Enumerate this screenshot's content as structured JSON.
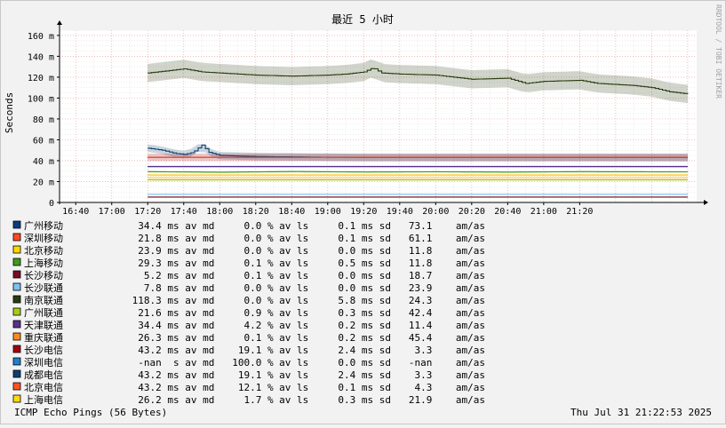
{
  "chart_data": {
    "type": "line",
    "title": "最近 5 小时",
    "ylabel": "Seconds",
    "watermark": "RRDTOOL / TOBI OETIKER",
    "ylim": [
      0,
      165
    ],
    "y_ticks": [
      {
        "value": 0,
        "label": "0"
      },
      {
        "value": 20,
        "label": "20 m"
      },
      {
        "value": 40,
        "label": "40 m"
      },
      {
        "value": 60,
        "label": "60 m"
      },
      {
        "value": 80,
        "label": "80 m"
      },
      {
        "value": 100,
        "label": "100 m"
      },
      {
        "value": 120,
        "label": "120 m"
      },
      {
        "value": 140,
        "label": "140 m"
      },
      {
        "value": 160,
        "label": "160 m"
      }
    ],
    "x_ticks": [
      "16:40",
      "17:00",
      "17:20",
      "17:40",
      "18:00",
      "18:20",
      "18:40",
      "19:00",
      "19:20",
      "19:40",
      "20:00",
      "20:20",
      "20:40",
      "21:00",
      "21:20"
    ],
    "x_range_minutes": [
      -49,
      305
    ],
    "series": [
      {
        "name": "广州移动",
        "color": "#0b3c83",
        "avg": 34.4,
        "loss": 0.0,
        "sd": 0.1,
        "ratio": "73.1",
        "unit": "ms",
        "points": [
          [
            0,
            34.4
          ],
          [
            300,
            34.4
          ]
        ]
      },
      {
        "name": "深圳移动",
        "color": "#ff4a25",
        "avg": 21.8,
        "loss": 0.0,
        "sd": 0.1,
        "ratio": "61.1",
        "unit": "ms",
        "points": [
          [
            0,
            21.8
          ],
          [
            300,
            21.8
          ]
        ]
      },
      {
        "name": "北京移动",
        "color": "#ffd700",
        "avg": 23.9,
        "loss": 0.0,
        "sd": 0.0,
        "ratio": "11.8",
        "unit": "ms",
        "points": [
          [
            0,
            23.9
          ],
          [
            300,
            23.9
          ]
        ]
      },
      {
        "name": "上海移动",
        "color": "#3f9b18",
        "avg": 29.3,
        "loss": 0.1,
        "sd": 0.5,
        "ratio": "11.8",
        "unit": "ms",
        "points": [
          [
            0,
            29.5
          ],
          [
            40,
            29.0
          ],
          [
            80,
            29.6
          ],
          [
            120,
            29.2
          ],
          [
            160,
            29.4
          ],
          [
            200,
            29.1
          ],
          [
            240,
            29.5
          ],
          [
            300,
            29.3
          ]
        ]
      },
      {
        "name": "长沙移动",
        "color": "#7a0b24",
        "avg": 5.2,
        "loss": 0.1,
        "sd": 0.0,
        "ratio": "18.7",
        "unit": "ms",
        "points": [
          [
            0,
            5.2
          ],
          [
            300,
            5.2
          ]
        ]
      },
      {
        "name": "长沙联通",
        "color": "#77c3f4",
        "avg": 7.8,
        "loss": 0.0,
        "sd": 0.0,
        "ratio": "23.9",
        "unit": "ms",
        "points": [
          [
            0,
            7.8
          ],
          [
            300,
            7.8
          ]
        ]
      },
      {
        "name": "南京联通",
        "color": "#283c0f",
        "avg": 118.3,
        "loss": 0.0,
        "sd": 5.8,
        "ratio": "24.3",
        "unit": "ms",
        "points": [
          [
            0,
            124
          ],
          [
            10,
            126
          ],
          [
            20,
            128
          ],
          [
            30,
            125
          ],
          [
            40,
            124
          ],
          [
            60,
            122
          ],
          [
            80,
            121
          ],
          [
            100,
            122
          ],
          [
            110,
            123
          ],
          [
            120,
            125
          ],
          [
            125,
            129
          ],
          [
            130,
            124
          ],
          [
            140,
            123
          ],
          [
            160,
            122
          ],
          [
            180,
            118
          ],
          [
            200,
            119
          ],
          [
            210,
            114
          ],
          [
            220,
            116
          ],
          [
            240,
            117
          ],
          [
            250,
            114
          ],
          [
            260,
            113
          ],
          [
            270,
            112
          ],
          [
            280,
            110
          ],
          [
            290,
            106
          ],
          [
            300,
            104
          ]
        ]
      },
      {
        "name": "广州联通",
        "color": "#a6cb16",
        "avg": 21.6,
        "loss": 0.9,
        "sd": 0.3,
        "ratio": "42.4",
        "unit": "ms",
        "points": [
          [
            0,
            21.6
          ],
          [
            300,
            21.6
          ]
        ]
      },
      {
        "name": "天津联通",
        "color": "#56318c",
        "avg": 34.4,
        "loss": 4.2,
        "sd": 0.2,
        "ratio": "11.4",
        "unit": "ms",
        "points": [
          [
            0,
            34.4
          ],
          [
            300,
            34.4
          ]
        ]
      },
      {
        "name": "重庆联通",
        "color": "#fc8b1e",
        "avg": 26.3,
        "loss": 0.1,
        "sd": 0.2,
        "ratio": "45.4",
        "unit": "ms",
        "points": [
          [
            0,
            26.3
          ],
          [
            300,
            26.3
          ]
        ]
      },
      {
        "name": "长沙电信",
        "color": "#a4000d",
        "avg": 43.2,
        "loss": 19.1,
        "sd": 2.4,
        "ratio": "3.3",
        "unit": "ms",
        "points": [
          [
            0,
            43.2
          ],
          [
            300,
            43.2
          ]
        ]
      },
      {
        "name": "深圳电信",
        "color": "#1f80cb",
        "avg": "-nan",
        "loss": 100.0,
        "sd": 0.0,
        "ratio": "-nan",
        "unit": "s",
        "points": []
      },
      {
        "name": "成都电信",
        "color": "#0e3f6e",
        "avg": 43.2,
        "loss": 19.1,
        "sd": 2.4,
        "ratio": "3.3",
        "unit": "ms",
        "points": [
          [
            0,
            52
          ],
          [
            8,
            50
          ],
          [
            15,
            47
          ],
          [
            20,
            46
          ],
          [
            25,
            48
          ],
          [
            30,
            55
          ],
          [
            34,
            48
          ],
          [
            40,
            45
          ],
          [
            60,
            44
          ],
          [
            120,
            43
          ],
          [
            180,
            43
          ],
          [
            240,
            43
          ],
          [
            300,
            43
          ]
        ]
      },
      {
        "name": "北京电信",
        "color": "#ff5420",
        "avg": 43.2,
        "loss": 12.1,
        "sd": 0.1,
        "ratio": "4.3",
        "unit": "ms",
        "points": [
          [
            0,
            43.2
          ],
          [
            300,
            43.2
          ]
        ]
      },
      {
        "name": "上海电信",
        "color": "#ffd812",
        "avg": 26.2,
        "loss": 1.7,
        "sd": 0.3,
        "ratio": "21.9",
        "unit": "ms",
        "points": [
          [
            0,
            26.2
          ],
          [
            300,
            26.2
          ]
        ]
      }
    ]
  },
  "legend_words": {
    "av": "av",
    "md": "md",
    "pct": "%",
    "ls": "ls",
    "sd": "sd",
    "ratio_unit": "am/as"
  },
  "footer": {
    "left": "ICMP Echo Pings (56 Bytes)",
    "right": "Thu Jul 31 21:22:53 2025"
  }
}
